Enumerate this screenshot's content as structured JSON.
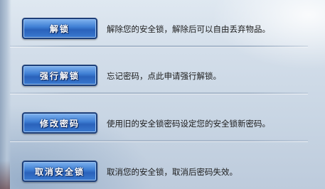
{
  "options": [
    {
      "button": "解锁",
      "description": "解除您的安全锁，解除后可以自由丢弃物品。"
    },
    {
      "button": "强行解锁",
      "description": "忘记密码，点此申请强行解锁。"
    },
    {
      "button": "修改密码",
      "description": "使用旧的安全锁密码设定您的安全锁新密码。"
    },
    {
      "button": "取消安全锁",
      "description": "取消您的安全锁，取消后密码失效。"
    }
  ],
  "colors": {
    "button_blue": "#3f7fd4",
    "button_border": "#1d3f7a",
    "panel_bg": "#d2dde9",
    "text": "#1c1c1c"
  }
}
